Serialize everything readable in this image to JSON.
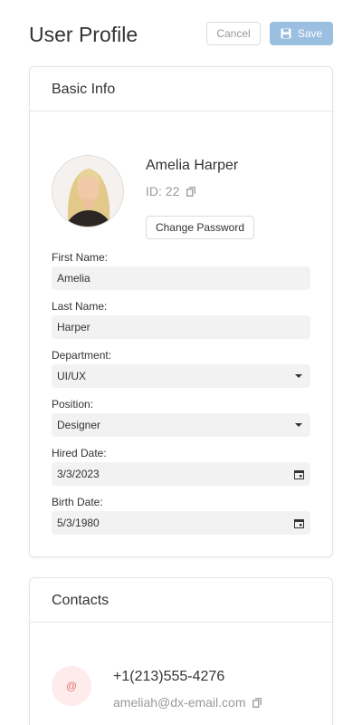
{
  "header": {
    "title": "User Profile",
    "cancel_label": "Cancel",
    "save_label": "Save"
  },
  "basic_info": {
    "title": "Basic Info",
    "full_name": "Amelia Harper",
    "id_text": "ID: 22",
    "change_password_label": "Change Password",
    "fields": {
      "first_name": {
        "label": "First Name:",
        "value": "Amelia"
      },
      "last_name": {
        "label": "Last Name:",
        "value": "Harper"
      },
      "department": {
        "label": "Department:",
        "value": "UI/UX"
      },
      "position": {
        "label": "Position:",
        "value": "Designer"
      },
      "hired_date": {
        "label": "Hired Date:",
        "value": "3/3/2023"
      },
      "birth_date": {
        "label": "Birth Date:",
        "value": "5/3/1980"
      }
    }
  },
  "contacts": {
    "title": "Contacts",
    "email_badge": "@",
    "phone": "+1(213)555-4276",
    "email": "ameliah@dx-email.com"
  },
  "colors": {
    "save_button": "#9bbfe0",
    "field_background": "#f2f2f2",
    "email_badge_background": "#fdeceb",
    "email_badge_text": "#e57373"
  },
  "icons": [
    "save-icon",
    "copy-icon",
    "dropdown-caret-icon",
    "calendar-icon"
  ]
}
